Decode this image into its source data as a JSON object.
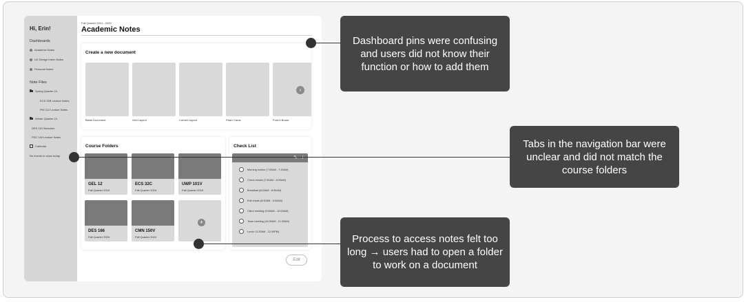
{
  "sidebar": {
    "greeting": "Hi, Erin!",
    "dashboards_heading": "Dashboards",
    "dashboards": [
      "Academic Notes",
      "UX Design Intern Notes",
      "Personal Notes"
    ],
    "note_files_heading": "Note Files",
    "note_files": {
      "spring_folder": "Spring Quarter 24",
      "spring_items": [
        "ECS 32B Lecture Notes",
        "PHI 112 Lecture Notes"
      ],
      "winter_folder": "Winter Quarter 24",
      "loose_items": [
        "DES 115 Sketches",
        "PSC 140 Lecture Notes"
      ]
    },
    "calendar_label": "Calendar",
    "no_events": "No events to show today."
  },
  "main": {
    "quarter": "Fall Quarter 2024 - 2025",
    "title": "Academic Notes",
    "create": {
      "title": "Create a new document",
      "templates": [
        "Blank Document",
        "Grid Layout",
        "Cornell Layout",
        "Flash Cards",
        "Post-It Board"
      ],
      "next_icon": "chevron-right-icon"
    },
    "courses": {
      "title": "Course Folders",
      "folders": [
        {
          "name": "GEL 12",
          "term": "Fall Quarter 2024"
        },
        {
          "name": "ECS 32C",
          "term": "Fall Quarter 2024"
        },
        {
          "name": "UWP 101V",
          "term": "Fall Quarter 2024"
        },
        {
          "name": "DES 166",
          "term": "Fall Quarter 2024"
        },
        {
          "name": "CMN 150V",
          "term": "Fall Quarter 2024"
        }
      ],
      "add_icon": "plus-icon"
    },
    "checklist": {
      "title": "Check List",
      "items": [
        "Morning routine (7:00AM - 7:30AM)",
        "Check emails (7:30AM - 8:00AM)",
        "Breakfast (8:00AM - 8:30AM)",
        "Edit charts (8:30AM - 9:00AM)",
        "Client meeting (9:00AM - 10:00AM)",
        "Team meeting (10:00AM - 11:30AM)",
        "Lunch 11:30AM - 12:30PM)"
      ]
    },
    "edit_label": "Edit"
  },
  "callouts": [
    "Dashboard pins were confusing and users did not know their function or how to add them",
    "Tabs in the navigation bar were unclear and did not match the course folders",
    "Process to access notes felt too long → users had to open a folder to work on a document"
  ],
  "colors": {
    "callout_bg": "#454545",
    "sidebar_bg": "#d6d6d6",
    "placeholder": "#d9d9d9",
    "folder_header": "#7a7a7a"
  }
}
